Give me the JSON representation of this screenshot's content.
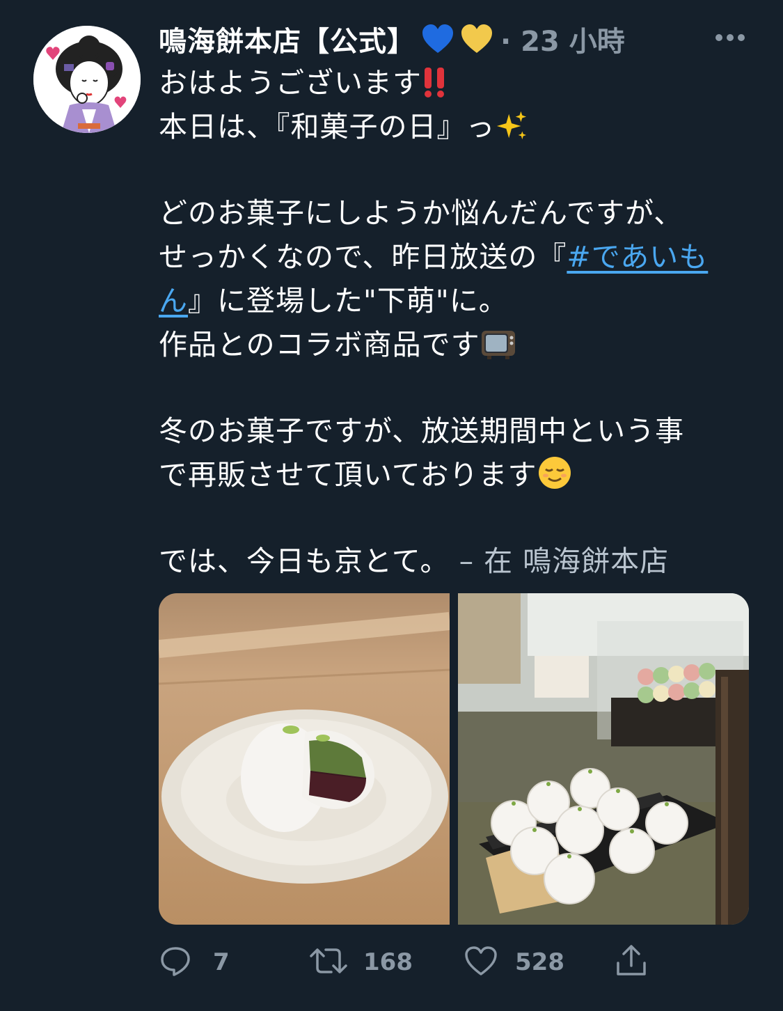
{
  "tweet": {
    "display_name": "鳴海餅本店【公式】",
    "meta": "· 23 小時",
    "lines": {
      "l1": "おはようございます",
      "l2a": "本日は、『和菓子の日』っ",
      "l3": "どのお菓子にしようか悩んだんですが、",
      "l4a": "せっかくなので、昨日放送の『",
      "l4b": "#であいも",
      "l5a": "ん",
      "l5b": "』に登場した\"下萌\"に。",
      "l6": "作品とのコラボ商品です",
      "l7": "冬のお菓子ですが、放送期間中という事",
      "l8": "で再販させて頂いております",
      "l9": "では、今日も京とて。",
      "location": " – 在 鳴海餅本店"
    }
  },
  "actions": {
    "reply_count": "7",
    "retweet_count": "168",
    "like_count": "528"
  },
  "icons": {
    "reply": "reply-icon",
    "retweet": "retweet-icon",
    "like": "like-icon",
    "share": "share-icon",
    "more": "more-icon"
  },
  "colors": {
    "background": "#15202b",
    "text": "#ffffff",
    "secondary": "#8b98a5",
    "link": "#4aa7f0",
    "blue_heart": "#1f6be0",
    "yellow_heart": "#f2c94c",
    "exclamation": "#e0333b"
  }
}
